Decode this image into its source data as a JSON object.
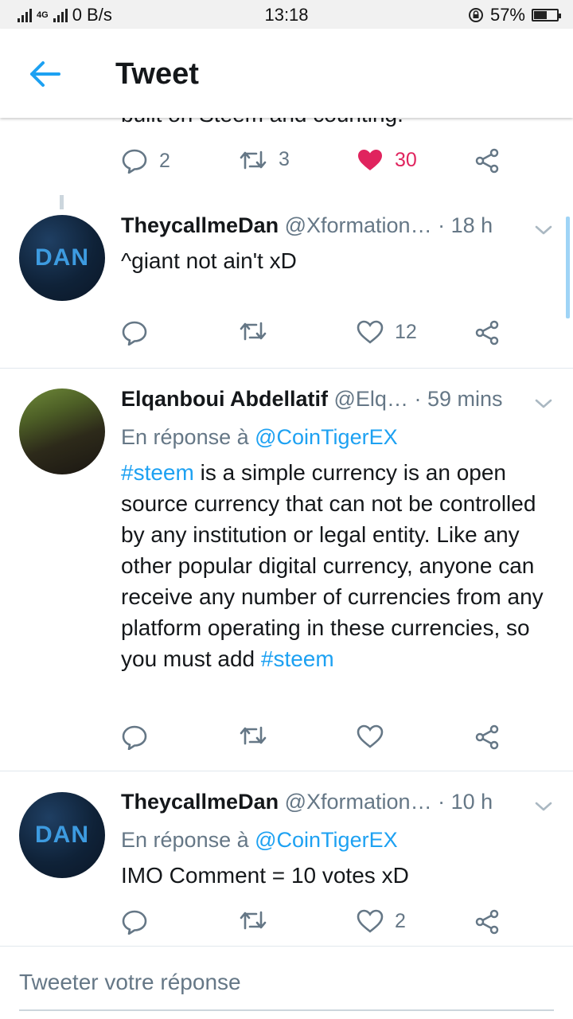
{
  "status_bar": {
    "network": "4G",
    "speed": "0 B/s",
    "time": "13:18",
    "battery": "57%",
    "battery_level": 0.57
  },
  "header": {
    "title": "Tweet",
    "back_icon": "back-arrow-icon",
    "accent_color": "#1da1f2"
  },
  "prev_tweet": {
    "cut_text": "built on Steem and counting.",
    "reply_count": "2",
    "retweet_count": "3",
    "like_count": "30",
    "liked": true
  },
  "replies": [
    {
      "name": "TheycallmeDan",
      "handle": "@Xformation…",
      "time": "· 18 h",
      "avatar_text": "DAN",
      "text": "^giant not ain't xD",
      "like_count": "12"
    },
    {
      "name": "Elqanboui Abdellatif",
      "handle": "@Elq…",
      "time": "· 59 mins",
      "reply_prefix": "En réponse à ",
      "reply_to": "@CoinTigerEX",
      "tag1": "#steem",
      "text": " is a simple currency is an open source currency that can not be controlled by any institution or legal entity. Like any other popular digital currency, anyone can receive any number of currencies from any platform operating in these currencies, so you must add ",
      "tag2": "#steem"
    },
    {
      "name": "TheycallmeDan",
      "handle": "@Xformation…",
      "time": "· 10 h",
      "avatar_text": "DAN",
      "reply_prefix": "En réponse à ",
      "reply_to": "@CoinTigerEX",
      "text": "IMO Comment = 10 votes xD",
      "like_count": "2"
    }
  ],
  "compose": {
    "placeholder": "Tweeter votre réponse"
  }
}
